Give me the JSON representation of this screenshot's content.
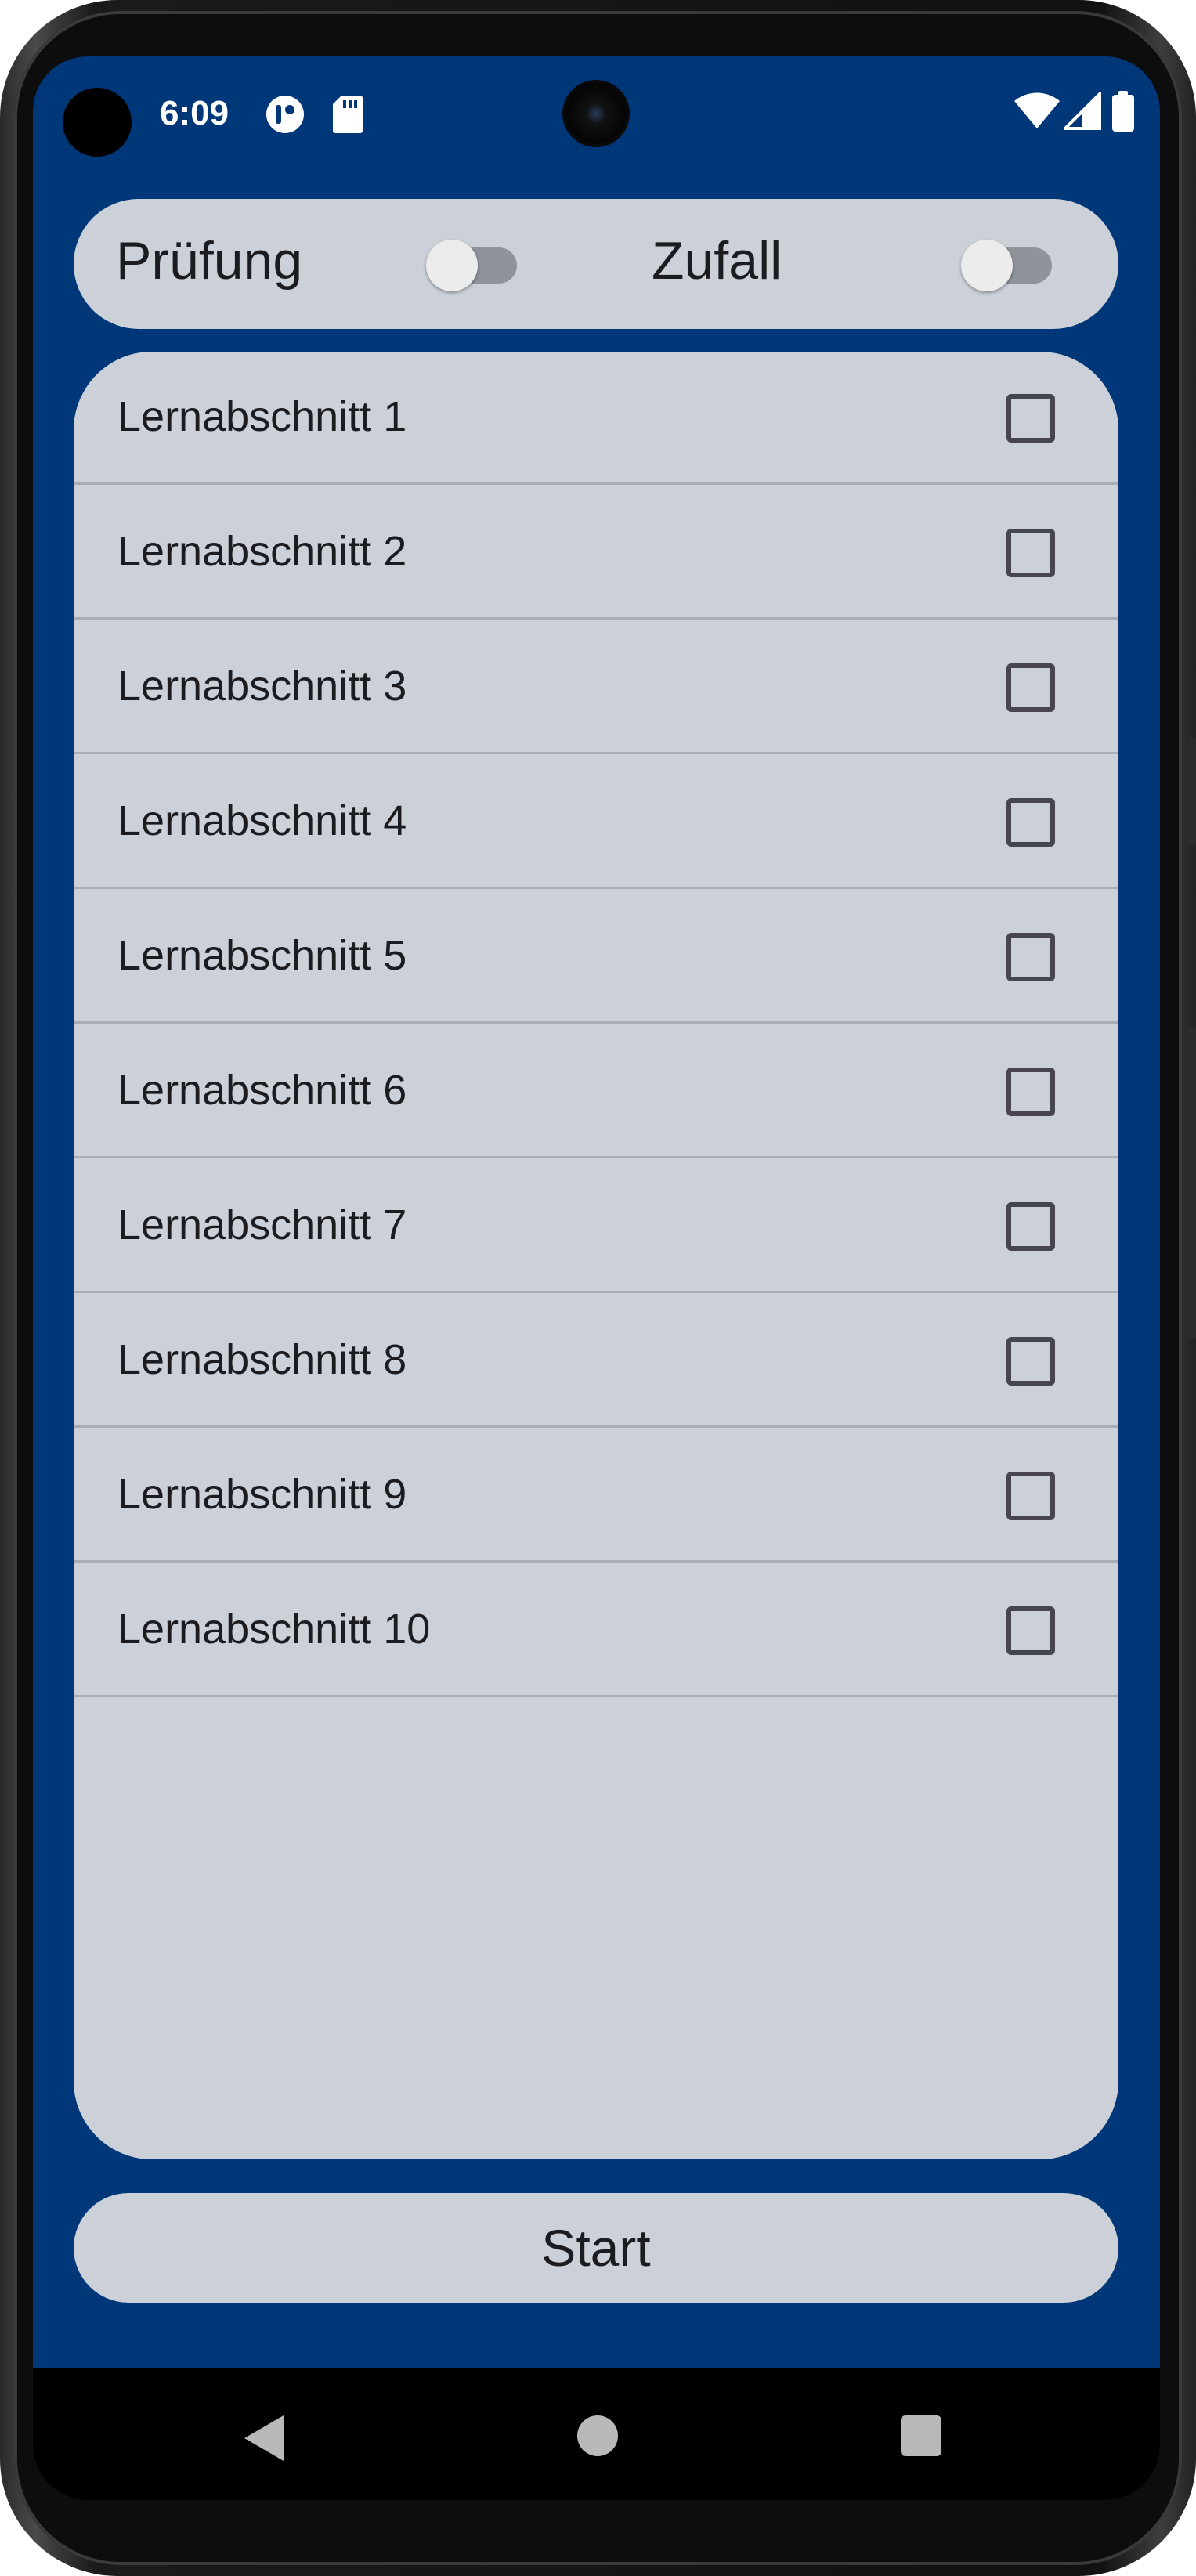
{
  "status_bar": {
    "time": "6:09"
  },
  "toggles": [
    {
      "label": "Prüfung",
      "checked": false
    },
    {
      "label": "Zufall",
      "checked": false
    }
  ],
  "sections": [
    {
      "label": "Lernabschnitt 1",
      "checked": false
    },
    {
      "label": "Lernabschnitt 2",
      "checked": false
    },
    {
      "label": "Lernabschnitt 3",
      "checked": false
    },
    {
      "label": "Lernabschnitt 4",
      "checked": false
    },
    {
      "label": "Lernabschnitt 5",
      "checked": false
    },
    {
      "label": "Lernabschnitt 6",
      "checked": false
    },
    {
      "label": "Lernabschnitt 7",
      "checked": false
    },
    {
      "label": "Lernabschnitt 8",
      "checked": false
    },
    {
      "label": "Lernabschnitt 9",
      "checked": false
    },
    {
      "label": "Lernabschnitt 10",
      "checked": false
    }
  ],
  "start_button": {
    "label": "Start"
  },
  "icons": {
    "status": [
      "app-notification-icon",
      "sd-card-icon",
      "wifi-icon",
      "cellular-signal-icon",
      "battery-icon"
    ],
    "nav": [
      "back-icon",
      "home-icon",
      "recent-apps-icon"
    ]
  },
  "colors": {
    "background": "#003778",
    "panel": "#ccd1d9",
    "text": "#1c1b1f",
    "checkbox_border": "#47464f",
    "switch_track": "#8f939b",
    "switch_thumb": "#ececec"
  }
}
